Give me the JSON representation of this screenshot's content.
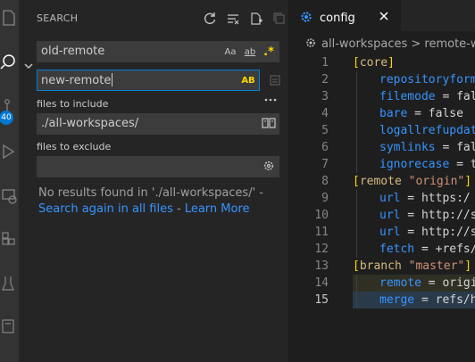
{
  "activity_bar": {
    "badge_count": "40"
  },
  "search": {
    "header_title": "SEARCH",
    "search_value": "old-remote",
    "replace_value": "new-remote",
    "option_match_case": "Aa",
    "option_whole_word": "ab",
    "option_regex": ".*",
    "option_preserve_case": "AB",
    "files_include_label": "files to include",
    "files_include_value": "./all-workspaces/",
    "files_exclude_label": "files to exclude",
    "files_exclude_value": "",
    "no_results_text": "No results found in './all-workspaces/' -",
    "search_again_link": "Search again in all files",
    "separator": " - ",
    "learn_more_link": "Learn More"
  },
  "editor": {
    "tab_name": "config",
    "breadcrumb": "all-workspaces > remote-worl",
    "lines": [
      {
        "n": "1",
        "text": "[core]"
      },
      {
        "n": "2",
        "text": "repositoryform"
      },
      {
        "n": "3",
        "text": "filemode = fal"
      },
      {
        "n": "4",
        "text": "bare = false"
      },
      {
        "n": "5",
        "text": "logallrefupdat"
      },
      {
        "n": "6",
        "text": "symlinks = fal"
      },
      {
        "n": "7",
        "text": "ignorecase = t"
      },
      {
        "n": "8",
        "text": "[remote \"origin\"]"
      },
      {
        "n": "9",
        "text": "url = https:/"
      },
      {
        "n": "10",
        "text": "url = http://s"
      },
      {
        "n": "11",
        "text": "url = http://s"
      },
      {
        "n": "12",
        "text": "fetch = +refs/"
      },
      {
        "n": "13",
        "text": "[branch \"master\"]"
      },
      {
        "n": "14",
        "text": "remote = origi"
      },
      {
        "n": "15",
        "text": "merge = refs/h"
      }
    ]
  },
  "colors": {
    "accent": "#007fd4",
    "link": "#3794ff",
    "section": "#d7ba7d",
    "bracket": "#ffd700",
    "key": "#3794ff"
  }
}
